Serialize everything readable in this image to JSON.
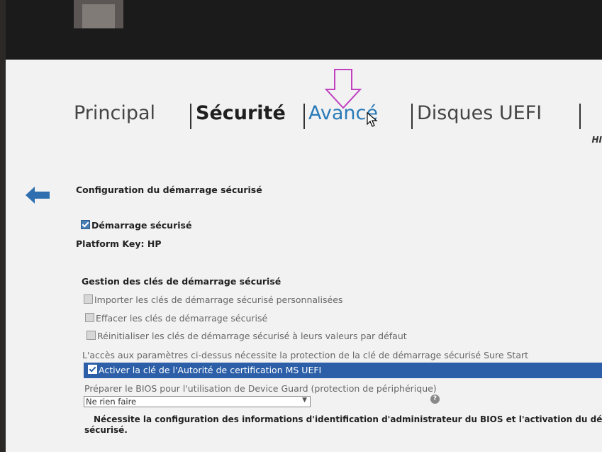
{
  "tabs": {
    "principal": "Principal",
    "securite": "Sécurité",
    "avance": "Avancé",
    "disques": "Disques UEFI"
  },
  "brand_mark": "HI",
  "section_title": "Configuration du démarrage sécurisé",
  "secure_boot": {
    "label": "Démarrage sécurisé",
    "checked": true
  },
  "platform_key": "Platform Key: HP",
  "key_management": {
    "title": "Gestion des clés de démarrage sécurisé",
    "import_label": "Importer les clés de démarrage sécurisé personnalisées",
    "clear_label": "Effacer les clés de démarrage sécurisé",
    "reset_label": "Réinitialiser les clés de démarrage sécurisé à leurs valeurs par défaut",
    "note": "L'accès aux paramètres ci-dessus nécessite la protection de la clé de démarrage sécurisé Sure Start",
    "ms_uefi_label": "Activer la clé de l'Autorité de certification MS UEFI",
    "ms_uefi_checked": true
  },
  "device_guard": {
    "label": "Préparer le BIOS pour l'utilisation de Device Guard (protection de périphérique)",
    "selected": "Ne rien faire",
    "help_icon": "question-icon"
  },
  "requirement": {
    "line1": "Nécessite la configuration des informations d'identification d'administrateur du BIOS et l'activation du démarra",
    "line2": "sécurisé."
  },
  "colors": {
    "accent": "#2a7ab8",
    "highlight": "#2c5fa8",
    "annotation": "#c040c0",
    "back_arrow": "#2f6fb0"
  }
}
